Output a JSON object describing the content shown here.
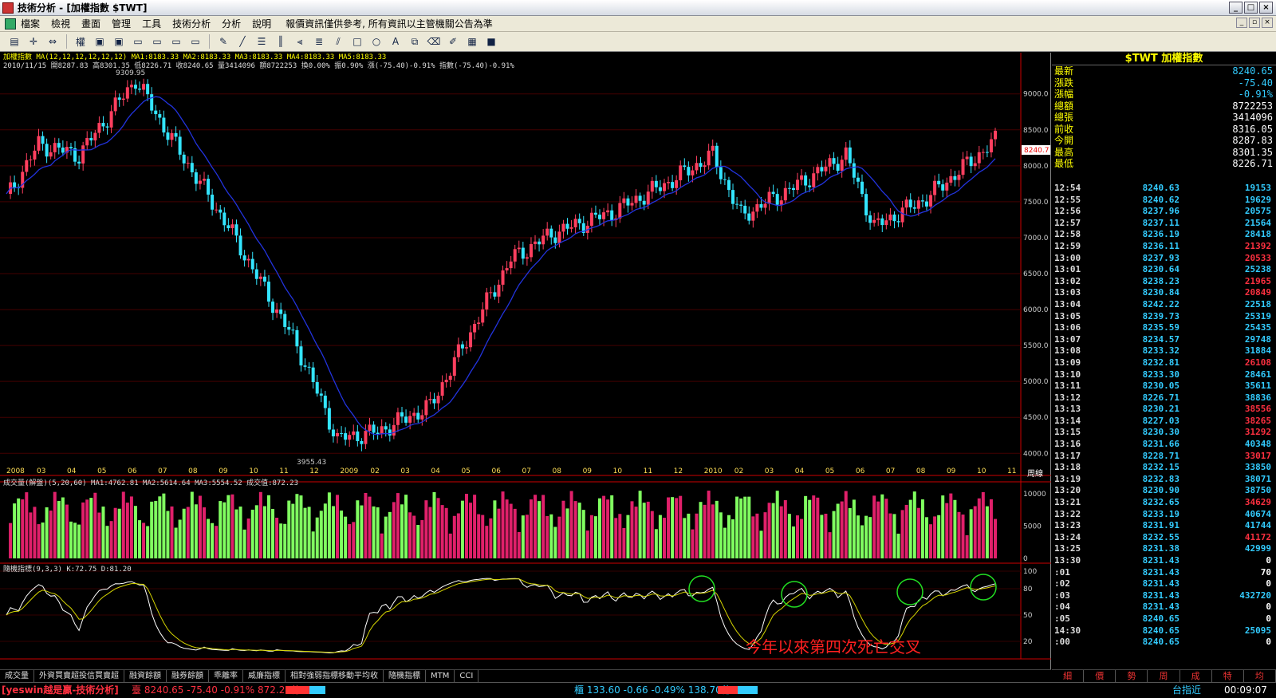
{
  "window": {
    "title": "技術分析 - [加權指數 $TWT]"
  },
  "menu": {
    "items": [
      "檔案",
      "檢視",
      "畫面",
      "管理",
      "工具",
      "技術分析",
      "分析",
      "說明"
    ],
    "info": "報價資訊僅供參考, 所有資訊以主管機關公告為準"
  },
  "toolbar": {
    "weight_label": "權"
  },
  "price_panel": {
    "header1": "加權指數 MA(12,12,12,12,12,12) MA1:8183.33 MA2:8183.33 MA3:8183.33 MA4:8183.33 MA5:8183.33",
    "header2": "2010/11/15 開8287.83 高8301.35 低8226.71 收8240.65 量3414096 額8722253 換0.00% 振0.90% 漲(-75.40)-0.91% 指數(-75.40)-0.91%",
    "high_label": "9309.95",
    "low_label": "3955.43",
    "last_tag": "8240.7",
    "y_labels": [
      "9000.0",
      "8500.0",
      "8000.0",
      "7500.0",
      "7000.0",
      "6500.0",
      "6000.0",
      "5500.0",
      "5000.0",
      "4500.0",
      "4000.0"
    ],
    "month_labels": [
      "2008",
      "03",
      "04",
      "05",
      "06",
      "07",
      "08",
      "09",
      "10",
      "11",
      "12",
      "2009",
      "02",
      "03",
      "04",
      "05",
      "06",
      "07",
      "08",
      "09",
      "10",
      "11",
      "12",
      "2010",
      "02",
      "03",
      "04",
      "05",
      "06",
      "07",
      "08",
      "09",
      "10",
      "11"
    ],
    "period_label": "周線"
  },
  "volume_panel": {
    "header": "成交量(解盤)(5,20,60) MA1:4762.81 MA2:5614.64 MA3:5554.52 成交值:872.23",
    "y_labels": [
      "10000",
      "5000",
      "0"
    ]
  },
  "kd_panel": {
    "header": "隨機指標(9,3,3) K:72.75 D:81.20",
    "y_labels": [
      "100",
      "80",
      "50",
      "20"
    ],
    "annotation": "今年以來第四次死亡交叉"
  },
  "bottom_tabs": [
    "成交量",
    "外資買賣超投信買賣超",
    "融資餘額",
    "融券餘額",
    "乖離率",
    "威廉指標",
    "相對強弱指標移動平均收",
    "隨機指標",
    "MTM",
    "CCI"
  ],
  "quote": {
    "title": "$TWT 加權指數",
    "rows": [
      {
        "k": "最新",
        "v": "8240.65"
      },
      {
        "k": "漲跌",
        "v": "-75.40"
      },
      {
        "k": "漲幅",
        "v": "-0.91%"
      },
      {
        "k": "總額",
        "v": "8722253"
      },
      {
        "k": "總張",
        "v": "3414096"
      },
      {
        "k": "前收",
        "v": "8316.05"
      },
      {
        "k": "今開",
        "v": "8287.83"
      },
      {
        "k": "最高",
        "v": "8301.35"
      },
      {
        "k": "最低",
        "v": "8226.71"
      }
    ],
    "ticks": [
      [
        "12:54",
        "8240.63",
        "19153"
      ],
      [
        "12:55",
        "8240.62",
        "19629"
      ],
      [
        "12:56",
        "8237.96",
        "20575"
      ],
      [
        "12:57",
        "8237.11",
        "21564"
      ],
      [
        "12:58",
        "8236.19",
        "28418"
      ],
      [
        "12:59",
        "8236.11",
        "21392"
      ],
      [
        "13:00",
        "8237.93",
        "20533"
      ],
      [
        "13:01",
        "8230.64",
        "25238"
      ],
      [
        "13:02",
        "8238.23",
        "21965"
      ],
      [
        "13:03",
        "8230.84",
        "20849"
      ],
      [
        "13:04",
        "8242.22",
        "22518"
      ],
      [
        "13:05",
        "8239.73",
        "25319"
      ],
      [
        "13:06",
        "8235.59",
        "25435"
      ],
      [
        "13:07",
        "8234.57",
        "29748"
      ],
      [
        "13:08",
        "8233.32",
        "31884"
      ],
      [
        "13:09",
        "8232.81",
        "26108"
      ],
      [
        "13:10",
        "8233.30",
        "28461"
      ],
      [
        "13:11",
        "8230.05",
        "35611"
      ],
      [
        "13:12",
        "8226.71",
        "38836"
      ],
      [
        "13:13",
        "8230.21",
        "38556"
      ],
      [
        "13:14",
        "8227.03",
        "38265"
      ],
      [
        "13:15",
        "8230.30",
        "31292"
      ],
      [
        "13:16",
        "8231.66",
        "40348"
      ],
      [
        "13:17",
        "8228.71",
        "33017"
      ],
      [
        "13:18",
        "8232.15",
        "33850"
      ],
      [
        "13:19",
        "8232.83",
        "38071"
      ],
      [
        "13:20",
        "8230.90",
        "38750"
      ],
      [
        "13:21",
        "8232.65",
        "34629"
      ],
      [
        "13:22",
        "8233.19",
        "40674"
      ],
      [
        "13:23",
        "8231.91",
        "41744"
      ],
      [
        "13:24",
        "8232.55",
        "41172"
      ],
      [
        "13:25",
        "8231.38",
        "42999"
      ],
      [
        "13:30",
        "8231.43",
        "0"
      ],
      [
        ":01",
        "8231.43",
        "70"
      ],
      [
        ":02",
        "8231.43",
        "0"
      ],
      [
        ":03",
        "8231.43",
        "432720"
      ],
      [
        ":04",
        "8231.43",
        "0"
      ],
      [
        ":05",
        "8240.65",
        "0"
      ],
      [
        "14:30",
        "8240.65",
        "25095"
      ],
      [
        ":00",
        "8240.65",
        "0"
      ]
    ],
    "tabs": [
      "細",
      "價",
      "勢",
      "周",
      "成",
      "特",
      "均"
    ]
  },
  "statusbar": {
    "brand": "[yeswin越是贏-技術分析]",
    "twse": "臺 8240.65 -75.40 -0.91% 872.23億",
    "otc": "櫃 133.60 -0.66 -0.49% 138.70億",
    "index_name": "台指近",
    "clock": "00:09:07"
  },
  "colors": {
    "up": "#ff3f5f",
    "down": "#33e5ff",
    "ma": "#2233dd",
    "k": "#ffffff",
    "d": "#d4d400",
    "vol_up": "#e0206a",
    "vol_down": "#80ff60",
    "highlight": "#22dd22"
  }
}
